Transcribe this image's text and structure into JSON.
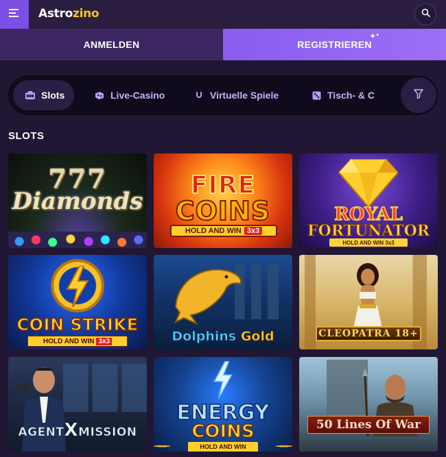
{
  "header": {
    "logo_part1": "Astro",
    "logo_part2": "zino"
  },
  "auth": {
    "login_label": "ANMELDEN",
    "register_label": "REGISTRIEREN"
  },
  "categories": [
    {
      "label": "Slots",
      "icon": "slot-machine-icon",
      "active": true
    },
    {
      "label": "Live-Casino",
      "icon": "live-casino-icon",
      "active": false
    },
    {
      "label": "Virtuelle Spiele",
      "icon": "virtual-games-icon",
      "active": false
    },
    {
      "label": "Tisch- & C",
      "icon": "table-games-icon",
      "active": false
    }
  ],
  "section": {
    "title": "SLOTS"
  },
  "games": [
    {
      "line1": "777",
      "line2": "Diamonds"
    },
    {
      "line1": "FIRE",
      "line2": "COINS",
      "band": "HOLD AND WIN",
      "badge": "3x3"
    },
    {
      "line1": "ROYAL",
      "line2": "FORTUNATOR",
      "band": "HOLD AND WIN 3x3"
    },
    {
      "line1": "COIN STRIKE",
      "band": "HOLD AND WIN",
      "badge": "3x3"
    },
    {
      "line1a": "Dolphins",
      "line1b": "Gold"
    },
    {
      "line1": "CLEOPATRA 18+"
    },
    {
      "line1a": "AGENT",
      "line1b": "X",
      "line1c": "MISSION"
    },
    {
      "line1": "ENERGY",
      "line2": "COINS",
      "band": "HOLD AND WIN"
    },
    {
      "line1": "50 Lines Of War"
    }
  ],
  "colors": {
    "background": "#211633",
    "accent": "#7c4ee4",
    "login_bg": "#3c2763",
    "register_bg": "#8a5cf0",
    "logo_highlight": "#f3c623"
  }
}
